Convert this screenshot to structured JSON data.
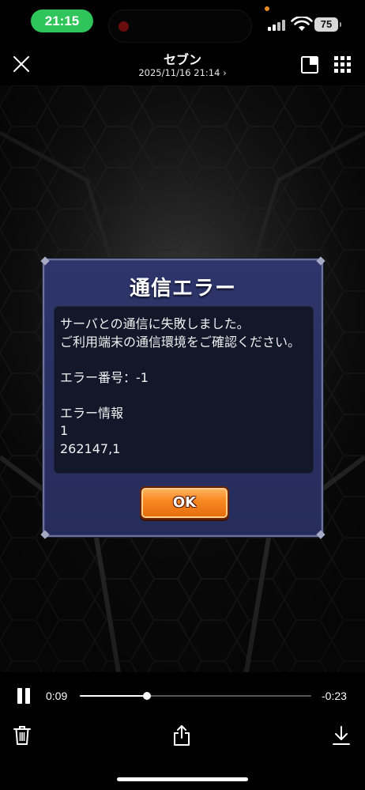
{
  "status_bar": {
    "time": "21:15",
    "battery": "75"
  },
  "nav": {
    "title": "セブン",
    "subtitle": "2025/11/16 21:14 ›"
  },
  "dialog": {
    "title": "通信エラー",
    "lines": [
      "サーバとの通信に失敗しました。",
      "ご利用端末の通信環境をご確認ください。",
      "",
      "エラー番号：-1",
      "",
      "エラー情報",
      "1",
      "262147,1"
    ],
    "ok_label": "OK"
  },
  "playback": {
    "elapsed": "0:09",
    "remaining": "-0:23",
    "progress": 0.29
  },
  "colors": {
    "time_pill": "#2fc55a",
    "dialog_bg": "#2a3163",
    "ok_button": "#f98a23"
  },
  "icons": [
    "close-icon",
    "pip-icon",
    "grid-icon",
    "pause-icon",
    "trash-icon",
    "share-icon",
    "download-icon"
  ]
}
